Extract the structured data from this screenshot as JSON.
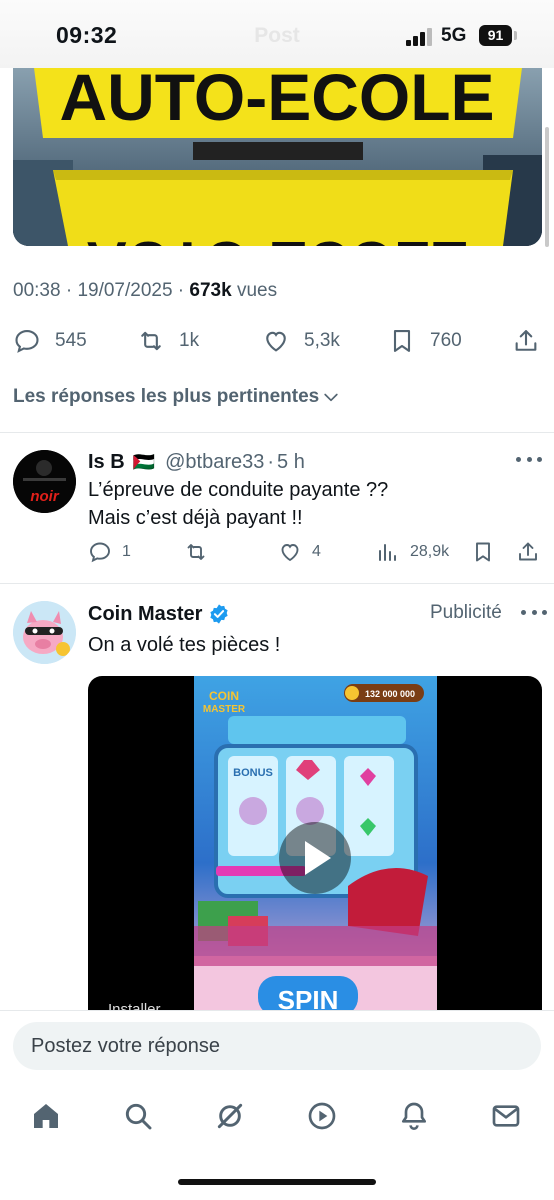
{
  "status": {
    "time": "09:32",
    "network": "5G",
    "battery": "91",
    "header_title": "Post"
  },
  "hero": {
    "sign_top": "AUTO-ECOLE",
    "sign_bottom": "AUTO-ECOLE"
  },
  "post_meta": {
    "time": "00:38",
    "date": "19/07/2025",
    "views_count": "673k",
    "views_label": "vues"
  },
  "post_actions": {
    "replies": "545",
    "reposts": "1k",
    "likes": "5,3k",
    "bookmarks": "760"
  },
  "sort_label": "Les réponses les plus pertinentes",
  "reply": {
    "name": "Is B",
    "flag": "🇵🇸",
    "handle": "@btbare33",
    "age": "5 h",
    "avatar_text": "noir",
    "line1": "L’épreuve de conduite payante ??",
    "line2": "Mais c’est déjà payant !!",
    "replies": "1",
    "likes": "4",
    "views": "28,9k"
  },
  "ad": {
    "name": "Coin Master",
    "badge": "Publicité",
    "text": "On a volé tes pièces !",
    "coins": "132 000 000",
    "bonus": "BONUS",
    "spin": "SPIN",
    "install": "Installer"
  },
  "reply_placeholder": "Postez votre réponse",
  "tabs": [
    "home-icon",
    "search-icon",
    "grok-icon",
    "video-icon",
    "notifications-icon",
    "messages-icon"
  ],
  "colors": {
    "accent": "#1d9bf0",
    "muted": "#536471",
    "sign_yellow": "#f4e21a"
  }
}
